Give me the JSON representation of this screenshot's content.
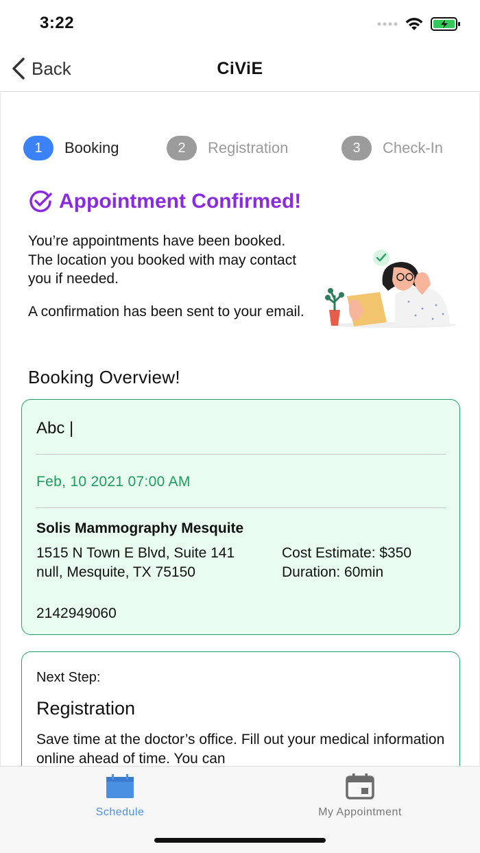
{
  "status_bar": {
    "time": "3:22"
  },
  "nav": {
    "back_label": "Back",
    "title": "CiViE"
  },
  "stepper": {
    "steps": [
      {
        "number": "1",
        "label": "Booking",
        "active": true
      },
      {
        "number": "2",
        "label": "Registration",
        "active": false
      },
      {
        "number": "3",
        "label": "Check-In",
        "active": false
      }
    ]
  },
  "confirmation": {
    "title": "Appointment Confirmed!",
    "message_1": "You’re appointments have been booked. The location you booked with may contact you if needed.",
    "message_2": "A confirmation has been sent to your email."
  },
  "overview": {
    "title": "Booking Overview!",
    "name": "Abc |",
    "date": "Feb, 10 2021 07:00 AM",
    "clinic": "Solis Mammography Mesquite",
    "address": "1515 N Town E Blvd, Suite 141 null, Mesquite, TX 75150",
    "cost": "Cost Estimate: $350 Duration: 60min",
    "phone": "2142949060"
  },
  "next_step": {
    "label": "Next Step:",
    "title": "Registration",
    "description": "Save time at the doctor’s office. Fill out your medical information online ahead of time. You can"
  },
  "tabs": [
    {
      "label": "Schedule",
      "active": true,
      "icon": "calendar-icon"
    },
    {
      "label": "My Appointment",
      "active": false,
      "icon": "calendar-event-icon"
    }
  ],
  "colors": {
    "accent_blue": "#3b82f6",
    "confirm_purple": "#8a2be2",
    "card_green_border": "#22a06b",
    "card_green_bg": "#e8fcef",
    "date_green": "#1e9b5e",
    "tab_active": "#4a90e2"
  }
}
